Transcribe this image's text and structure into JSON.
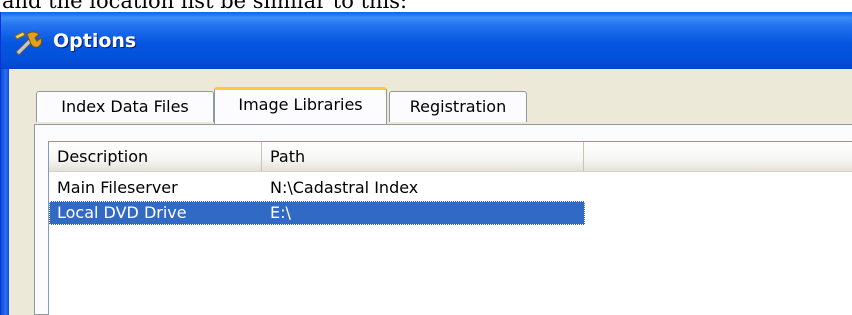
{
  "caption": "and the location list be similar to this:",
  "window": {
    "title": "Options"
  },
  "tabs": [
    {
      "label": "Index Data Files",
      "active": false
    },
    {
      "label": "Image Libraries",
      "active": true
    },
    {
      "label": "Registration",
      "active": false
    }
  ],
  "list": {
    "columns": [
      "Description",
      "Path",
      ""
    ],
    "rows": [
      {
        "description": "Main Fileserver",
        "path": "N:\\Cadastral Index",
        "selected": false
      },
      {
        "description": "Local DVD Drive",
        "path": "E:\\",
        "selected": true
      }
    ]
  },
  "colors": {
    "titlebar": "#0555e0",
    "selection": "#316ac5",
    "active_tab_accent": "#ffc83c",
    "dialog_background": "#ece9d8"
  },
  "icons": {
    "title_icon": "options-wrench-icon"
  }
}
